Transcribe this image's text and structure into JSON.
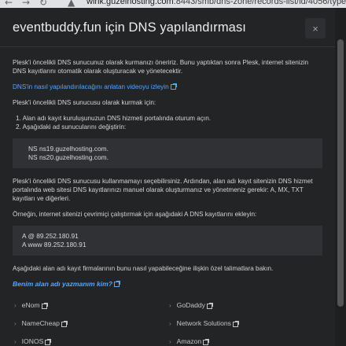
{
  "browser": {
    "url_host": "wink.guzelhosting.com",
    "url_rest": ":8443/smb/dns-zone/records-list/id/4056/type/domain"
  },
  "modal": {
    "title": "eventbuddy.fun için DNS yapılandırması",
    "close_label": "×",
    "intro": "Plesk'i öncelikli DNS sunucunuz olarak kurmanızı öneririz. Bunu yaptıktan sonra Plesk, internet sitenizin DNS kayıtlarını otomatik olarak oluşturacak ve yönetecektir.",
    "video_link": "DNS'in nasıl yapılandırılacağını anlatan videoyu izleyin",
    "setup_heading": "Plesk'i öncelikli DNS sunucusu olarak kurmak için:",
    "steps": [
      "1. Alan adı kayıt kuruluşunuzun DNS hizmeti portalında oturum açın.",
      "2. Aşağıdaki ad sunucularını değiştirin:"
    ],
    "nameservers": [
      "NS ns19.guzelhosting.com.",
      "NS ns20.guzelhosting.com."
    ],
    "manual_text": "Plesk'i öncelikli DNS sunucusu kullanmamayı seçebilirsiniz. Ardından, alan adı kayıt sitenizin DNS hizmet portalında web sitesi DNS kayıtlarınızı manuel olarak oluşturmanız ve yönetmeniz gerekir: A, MX, TXT kayıtları ve diğerleri.",
    "example_text": "Örneğin, internet sitenizi çevrimiçi çalıştırmak için aşağıdaki A DNS kayıtlarını ekleyin:",
    "a_records": [
      "A @ 89.252.180.91",
      "A www 89.252.180.91"
    ],
    "instructions_text": "Aşağıdaki alan adı kayıt firmalarının bunu nasıl yapabileceğine ilişkin özel talimatlara bakın.",
    "registrar_link": "Benim alan adı yazmanım kim?",
    "providers_left": [
      "eNom",
      "NameCheap",
      "IONOS"
    ],
    "providers_right": [
      "GoDaddy",
      "Network Solutions",
      "Amazon"
    ]
  },
  "background": {
    "partial_letter": "y"
  }
}
